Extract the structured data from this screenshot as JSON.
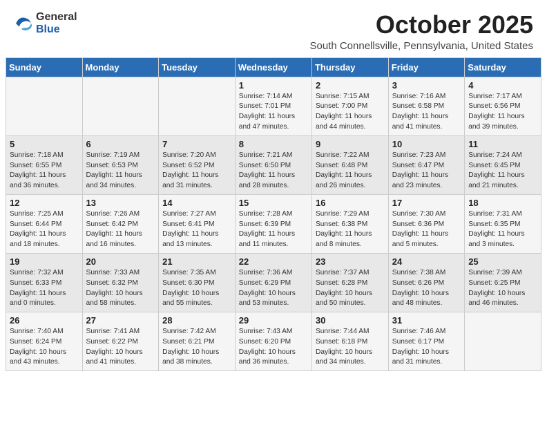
{
  "header": {
    "logo_general": "General",
    "logo_blue": "Blue",
    "month_title": "October 2025",
    "subtitle": "South Connellsville, Pennsylvania, United States"
  },
  "days_of_week": [
    "Sunday",
    "Monday",
    "Tuesday",
    "Wednesday",
    "Thursday",
    "Friday",
    "Saturday"
  ],
  "weeks": [
    [
      {
        "day": "",
        "info": ""
      },
      {
        "day": "",
        "info": ""
      },
      {
        "day": "",
        "info": ""
      },
      {
        "day": "1",
        "info": "Sunrise: 7:14 AM\nSunset: 7:01 PM\nDaylight: 11 hours\nand 47 minutes."
      },
      {
        "day": "2",
        "info": "Sunrise: 7:15 AM\nSunset: 7:00 PM\nDaylight: 11 hours\nand 44 minutes."
      },
      {
        "day": "3",
        "info": "Sunrise: 7:16 AM\nSunset: 6:58 PM\nDaylight: 11 hours\nand 41 minutes."
      },
      {
        "day": "4",
        "info": "Sunrise: 7:17 AM\nSunset: 6:56 PM\nDaylight: 11 hours\nand 39 minutes."
      }
    ],
    [
      {
        "day": "5",
        "info": "Sunrise: 7:18 AM\nSunset: 6:55 PM\nDaylight: 11 hours\nand 36 minutes."
      },
      {
        "day": "6",
        "info": "Sunrise: 7:19 AM\nSunset: 6:53 PM\nDaylight: 11 hours\nand 34 minutes."
      },
      {
        "day": "7",
        "info": "Sunrise: 7:20 AM\nSunset: 6:52 PM\nDaylight: 11 hours\nand 31 minutes."
      },
      {
        "day": "8",
        "info": "Sunrise: 7:21 AM\nSunset: 6:50 PM\nDaylight: 11 hours\nand 28 minutes."
      },
      {
        "day": "9",
        "info": "Sunrise: 7:22 AM\nSunset: 6:48 PM\nDaylight: 11 hours\nand 26 minutes."
      },
      {
        "day": "10",
        "info": "Sunrise: 7:23 AM\nSunset: 6:47 PM\nDaylight: 11 hours\nand 23 minutes."
      },
      {
        "day": "11",
        "info": "Sunrise: 7:24 AM\nSunset: 6:45 PM\nDaylight: 11 hours\nand 21 minutes."
      }
    ],
    [
      {
        "day": "12",
        "info": "Sunrise: 7:25 AM\nSunset: 6:44 PM\nDaylight: 11 hours\nand 18 minutes."
      },
      {
        "day": "13",
        "info": "Sunrise: 7:26 AM\nSunset: 6:42 PM\nDaylight: 11 hours\nand 16 minutes."
      },
      {
        "day": "14",
        "info": "Sunrise: 7:27 AM\nSunset: 6:41 PM\nDaylight: 11 hours\nand 13 minutes."
      },
      {
        "day": "15",
        "info": "Sunrise: 7:28 AM\nSunset: 6:39 PM\nDaylight: 11 hours\nand 11 minutes."
      },
      {
        "day": "16",
        "info": "Sunrise: 7:29 AM\nSunset: 6:38 PM\nDaylight: 11 hours\nand 8 minutes."
      },
      {
        "day": "17",
        "info": "Sunrise: 7:30 AM\nSunset: 6:36 PM\nDaylight: 11 hours\nand 5 minutes."
      },
      {
        "day": "18",
        "info": "Sunrise: 7:31 AM\nSunset: 6:35 PM\nDaylight: 11 hours\nand 3 minutes."
      }
    ],
    [
      {
        "day": "19",
        "info": "Sunrise: 7:32 AM\nSunset: 6:33 PM\nDaylight: 11 hours\nand 0 minutes."
      },
      {
        "day": "20",
        "info": "Sunrise: 7:33 AM\nSunset: 6:32 PM\nDaylight: 10 hours\nand 58 minutes."
      },
      {
        "day": "21",
        "info": "Sunrise: 7:35 AM\nSunset: 6:30 PM\nDaylight: 10 hours\nand 55 minutes."
      },
      {
        "day": "22",
        "info": "Sunrise: 7:36 AM\nSunset: 6:29 PM\nDaylight: 10 hours\nand 53 minutes."
      },
      {
        "day": "23",
        "info": "Sunrise: 7:37 AM\nSunset: 6:28 PM\nDaylight: 10 hours\nand 50 minutes."
      },
      {
        "day": "24",
        "info": "Sunrise: 7:38 AM\nSunset: 6:26 PM\nDaylight: 10 hours\nand 48 minutes."
      },
      {
        "day": "25",
        "info": "Sunrise: 7:39 AM\nSunset: 6:25 PM\nDaylight: 10 hours\nand 46 minutes."
      }
    ],
    [
      {
        "day": "26",
        "info": "Sunrise: 7:40 AM\nSunset: 6:24 PM\nDaylight: 10 hours\nand 43 minutes."
      },
      {
        "day": "27",
        "info": "Sunrise: 7:41 AM\nSunset: 6:22 PM\nDaylight: 10 hours\nand 41 minutes."
      },
      {
        "day": "28",
        "info": "Sunrise: 7:42 AM\nSunset: 6:21 PM\nDaylight: 10 hours\nand 38 minutes."
      },
      {
        "day": "29",
        "info": "Sunrise: 7:43 AM\nSunset: 6:20 PM\nDaylight: 10 hours\nand 36 minutes."
      },
      {
        "day": "30",
        "info": "Sunrise: 7:44 AM\nSunset: 6:18 PM\nDaylight: 10 hours\nand 34 minutes."
      },
      {
        "day": "31",
        "info": "Sunrise: 7:46 AM\nSunset: 6:17 PM\nDaylight: 10 hours\nand 31 minutes."
      },
      {
        "day": "",
        "info": ""
      }
    ]
  ]
}
